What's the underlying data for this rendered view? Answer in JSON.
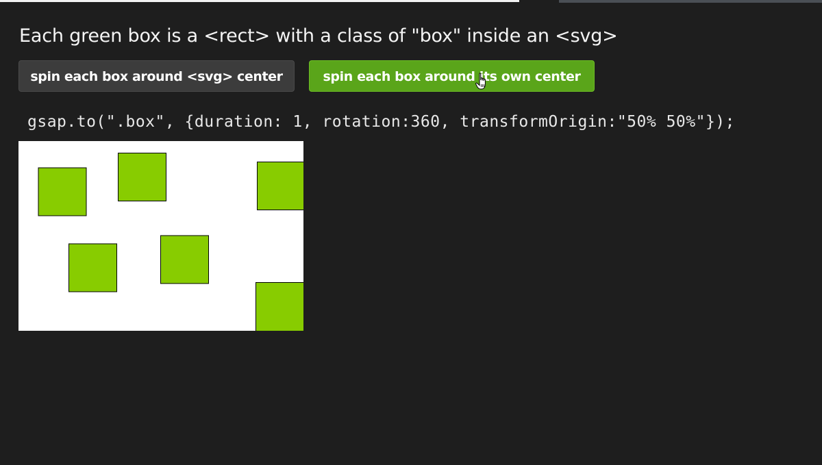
{
  "heading": "Each green box is a <rect> with a class of \"box\" inside an <svg>",
  "buttons": {
    "svg_center": "spin each box around <svg> center",
    "own_center": "spin each box around its own center"
  },
  "code": "gsap.to(\".box\", {duration: 1, rotation:360, transformOrigin:\"50% 50%\"});",
  "colors": {
    "background": "#1e1e1e",
    "box_fill": "#88cc00",
    "box_stroke": "#000000",
    "active_button": "#5aa51a",
    "inactive_button": "#3c3c3c",
    "stage": "#ffffff"
  },
  "icons": {
    "cursor": "hand-pointer-icon"
  }
}
